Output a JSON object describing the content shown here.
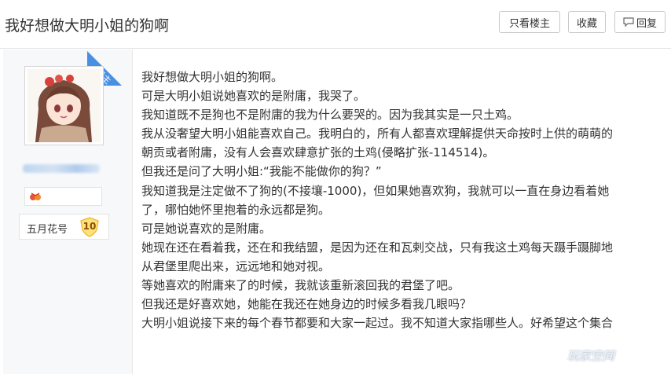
{
  "header": {
    "title": "我好想做大明小姐的狗啊",
    "btn_only_lz": "只看楼主",
    "btn_favorite": "收藏",
    "btn_reply": "回复"
  },
  "sidebar": {
    "lz_tag": "楼主",
    "badge_icon": "badge-icon",
    "level_name": "五月花号",
    "level_num": "10"
  },
  "post": {
    "lines": [
      "我好想做大明小姐的狗啊。",
      "可是大明小姐说她喜欢的是附庸，我哭了。",
      "我知道既不是狗也不是附庸的我为什么要哭的。因为我其实是一只土鸡。",
      "我从没奢望大明小姐能喜欢自己。我明白的，所有人都喜欢理解提供天命按时上供的萌萌的",
      "朝贡或者附庸，没有人会喜欢肆意扩张的土鸡(侵略扩张-114514)。",
      "但我还是问了大明小姐:“我能不能做你的狗？”",
      "我知道我是注定做不了狗的(不接壤-1000)，但如果她喜欢狗，我就可以一直在身边看着她",
      "了，哪怕她怀里抱着的永远都是狗。",
      "可是她说喜欢的是附庸。",
      "她现在还在看着我，还在和我结盟，是因为还在和瓦剌交战，只有我这土鸡每天蹑手蹑脚地",
      "从君堡里爬出来，远远地和她对视。",
      "等她喜欢的附庸来了的时候，我就该重新滚回我的君堡了吧。",
      "但我还是好喜欢她，她能在我还在她身边的时候多看我几眼吗？",
      "大明小姐说接下来的每个春节都要和大家一起过。我不知道大家指哪些人。好希望这个集合"
    ]
  },
  "watermark": "玩家空间"
}
